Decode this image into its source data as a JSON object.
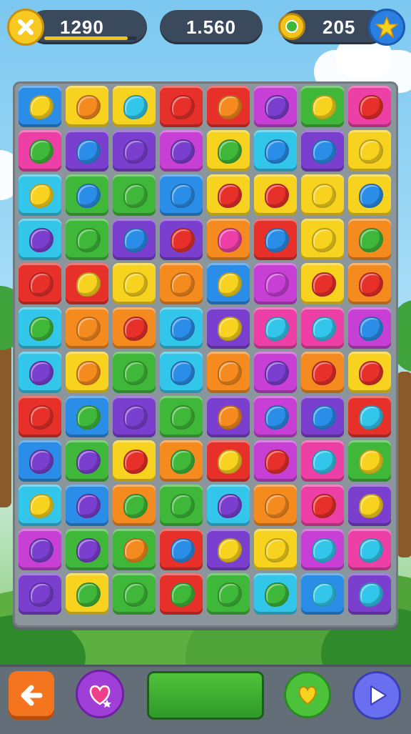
{
  "hud": {
    "score": "1290",
    "target": "1.560",
    "coins": "205",
    "score_progress": 0.9
  },
  "palette": {
    "yellow": "#f7d21e",
    "orange": "#f58a1f",
    "red": "#e8302a",
    "pink": "#ee3fa6",
    "magenta": "#c83fd6",
    "purple": "#7b3fd0",
    "blue": "#2a8ee8",
    "cyan": "#32c6ea",
    "green": "#3fb83a"
  },
  "board": {
    "rows": 12,
    "cols": 8,
    "tiles": [
      [
        "blue",
        "yellow",
        "yellow",
        "red",
        "red",
        "magenta",
        "green",
        "pink"
      ],
      [
        "pink",
        "purple",
        "purple",
        "magenta",
        "yellow",
        "cyan",
        "purple",
        "yellow"
      ],
      [
        "cyan",
        "green",
        "green",
        "blue",
        "yellow",
        "yellow",
        "yellow",
        "yellow"
      ],
      [
        "cyan",
        "green",
        "purple",
        "purple",
        "orange",
        "red",
        "yellow",
        "orange"
      ],
      [
        "red",
        "red",
        "yellow",
        "orange",
        "blue",
        "magenta",
        "yellow",
        "orange"
      ],
      [
        "cyan",
        "orange",
        "orange",
        "cyan",
        "purple",
        "pink",
        "pink",
        "magenta"
      ],
      [
        "cyan",
        "yellow",
        "green",
        "cyan",
        "orange",
        "magenta",
        "orange",
        "yellow"
      ],
      [
        "red",
        "blue",
        "purple",
        "green",
        "purple",
        "magenta",
        "purple",
        "red"
      ],
      [
        "blue",
        "green",
        "yellow",
        "orange",
        "red",
        "magenta",
        "pink",
        "green"
      ],
      [
        "cyan",
        "blue",
        "orange",
        "green",
        "cyan",
        "orange",
        "pink",
        "purple"
      ],
      [
        "magenta",
        "green",
        "green",
        "red",
        "purple",
        "yellow",
        "magenta",
        "pink"
      ],
      [
        "purple",
        "yellow",
        "green",
        "red",
        "green",
        "cyan",
        "blue",
        "purple"
      ]
    ],
    "gems": [
      [
        "yellow",
        "orange",
        "cyan",
        "red",
        "orange",
        "purple",
        "yellow",
        "red"
      ],
      [
        "green",
        "blue",
        "purple",
        "purple",
        "green",
        "blue",
        "blue",
        "yellow"
      ],
      [
        "yellow",
        "blue",
        "green",
        "blue",
        "red",
        "red",
        "yellow",
        "blue"
      ],
      [
        "purple",
        "green",
        "blue",
        "red",
        "pink",
        "blue",
        "yellow",
        "green"
      ],
      [
        "red",
        "yellow",
        "yellow",
        "orange",
        "yellow",
        "magenta",
        "red",
        "red"
      ],
      [
        "green",
        "orange",
        "red",
        "blue",
        "yellow",
        "cyan",
        "cyan",
        "blue"
      ],
      [
        "purple",
        "orange",
        "green",
        "blue",
        "orange",
        "purple",
        "red",
        "red"
      ],
      [
        "red",
        "green",
        "purple",
        "green",
        "orange",
        "blue",
        "blue",
        "cyan"
      ],
      [
        "purple",
        "purple",
        "red",
        "green",
        "yellow",
        "red",
        "cyan",
        "yellow"
      ],
      [
        "yellow",
        "purple",
        "green",
        "green",
        "purple",
        "orange",
        "red",
        "yellow"
      ],
      [
        "purple",
        "purple",
        "orange",
        "blue",
        "yellow",
        "yellow",
        "cyan",
        "cyan"
      ],
      [
        "purple",
        "green",
        "green",
        "green",
        "green",
        "green",
        "cyan",
        "cyan"
      ]
    ]
  },
  "toolbar": {
    "back_icon": "arrow-left-icon",
    "booster_icon": "heart-potion-icon",
    "meter_fill": 1.0,
    "heart_icon": "heart-icon",
    "play_icon": "play-icon"
  }
}
